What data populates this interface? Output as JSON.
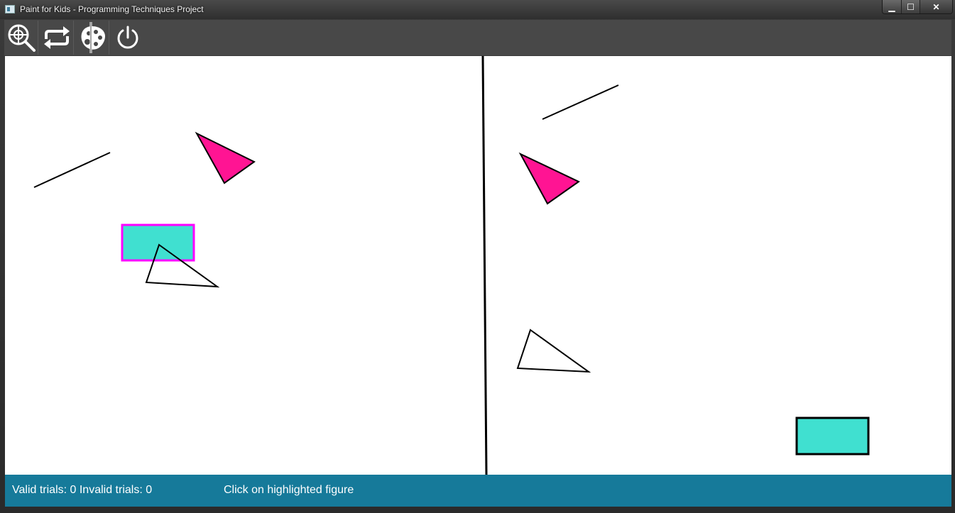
{
  "window": {
    "title": "Paint for Kids - Programming Techniques Project",
    "controls": {
      "minimize": "▁",
      "maximize": "☐",
      "close": "✕"
    }
  },
  "toolbar": {
    "items": [
      {
        "name": "zoom-target-tool",
        "icon": "magnifier-crosshair-icon"
      },
      {
        "name": "swap-mode-tool",
        "icon": "repeat-arrows-icon"
      },
      {
        "name": "draw-mode-tool",
        "icon": "palette-brush-icon"
      },
      {
        "name": "exit-tool",
        "icon": "power-icon"
      }
    ]
  },
  "canvas": {
    "colors": {
      "highlight_border": "#ff00ff",
      "pink_fill": "#ff1493",
      "turquoise_fill": "#40e0d0",
      "stroke": "#000000"
    }
  },
  "status": {
    "trials": "Valid trials: 0 Invalid trials: 0",
    "message": "Click on highlighted figure",
    "bar_color": "#167a9a"
  }
}
